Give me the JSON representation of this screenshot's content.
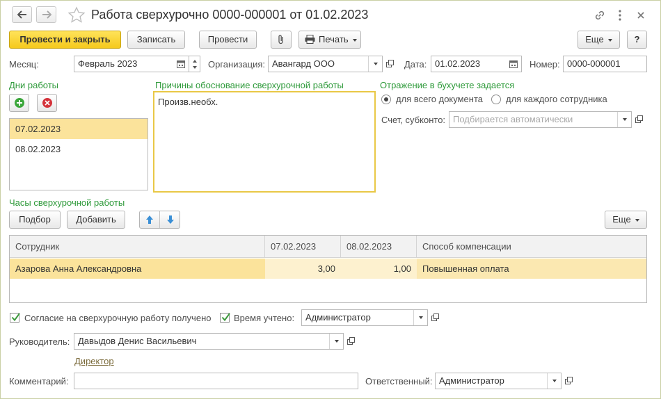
{
  "window": {
    "title": "Работа сверхурочно 0000-000001 от 01.02.2023"
  },
  "toolbar": {
    "post_close": "Провести и закрыть",
    "write": "Записать",
    "post": "Провести",
    "print": "Печать",
    "more": "Еще",
    "help": "?"
  },
  "header": {
    "month_label": "Месяц:",
    "month_value": "Февраль 2023",
    "org_label": "Организация:",
    "org_value": "Авангард ООО",
    "date_label": "Дата:",
    "date_value": "01.02.2023",
    "number_label": "Номер:",
    "number_value": "0000-000001"
  },
  "work_days": {
    "title": "Дни работы",
    "items": [
      "07.02.2023",
      "08.02.2023"
    ]
  },
  "reasons": {
    "title": "Причины обоснование сверхурочной работы",
    "text": "Произв.необх."
  },
  "accounting": {
    "title": "Отражение в бухучете задается",
    "option_all": "для всего документа",
    "option_each": "для каждого сотрудника",
    "selected": "для всего документа",
    "account_label": "Счет, субконто:",
    "account_placeholder": "Подбирается автоматически"
  },
  "hours": {
    "title": "Часы сверхурочной работы",
    "pick": "Подбор",
    "add": "Добавить",
    "more": "Еще",
    "columns": [
      "Сотрудник",
      "07.02.2023",
      "08.02.2023",
      "Способ компенсации"
    ],
    "rows": [
      {
        "employee": "Азарова Анна Александровна",
        "d1": "3,00",
        "d2": "1,00",
        "comp": "Повышенная оплата"
      }
    ]
  },
  "footer": {
    "consent_label": "Согласие на сверхурочную работу получено",
    "consent_checked": true,
    "time_label": "Время учтено:",
    "time_checked": true,
    "time_value": "Администратор",
    "manager_label": "Руководитель:",
    "manager_value": "Давыдов Денис Васильевич",
    "manager_position": "Директор",
    "comment_label": "Комментарий:",
    "comment_value": "",
    "responsible_label": "Ответственный:",
    "responsible_value": "Администратор"
  },
  "colors": {
    "accent_yellow": "#f5c91c",
    "group_title_green": "#2e9a3a",
    "selection": "#fbe39b"
  }
}
